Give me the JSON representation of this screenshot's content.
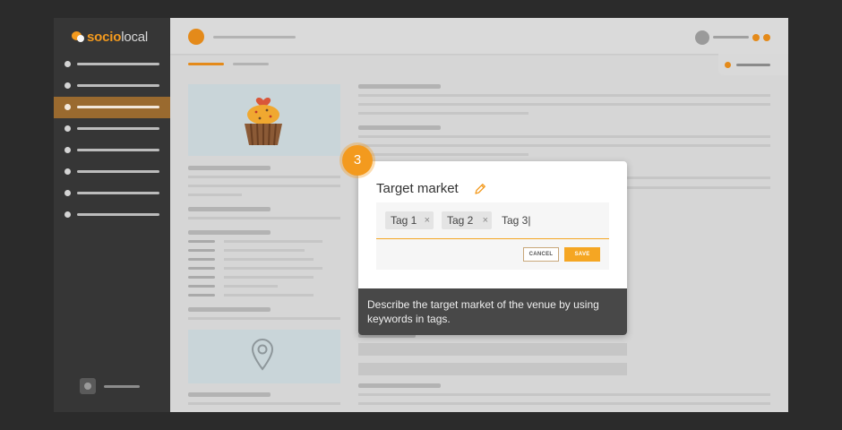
{
  "app": {
    "brand_part1": "socio",
    "brand_part2": "local"
  },
  "sidebar": {
    "items": [
      {
        "name": "nav-item-1"
      },
      {
        "name": "nav-item-2"
      },
      {
        "name": "nav-item-3",
        "active": true
      },
      {
        "name": "nav-item-4"
      },
      {
        "name": "nav-item-5"
      },
      {
        "name": "nav-item-6"
      },
      {
        "name": "nav-item-7"
      },
      {
        "name": "nav-item-8"
      }
    ]
  },
  "walkthrough": {
    "step_number": "3"
  },
  "modal": {
    "title": "Target market",
    "tags": [
      {
        "label": "Tag 1",
        "remove": "×"
      },
      {
        "label": "Tag 2",
        "remove": "×"
      }
    ],
    "input_value": "Tag 3|",
    "cancel_label": "CANCEL",
    "save_label": "SAVE",
    "tooltip": "Describe the target market of the venue by using keywords in tags."
  },
  "colors": {
    "accent": "#f39a1e",
    "sidebar_bg": "#363636",
    "active_nav": "#9a6a2f",
    "tooltip_bg": "#484848"
  },
  "icons": [
    "chat-logo-icon",
    "pencil-icon",
    "cupcake-image",
    "location-pin-icon",
    "close-icon"
  ]
}
